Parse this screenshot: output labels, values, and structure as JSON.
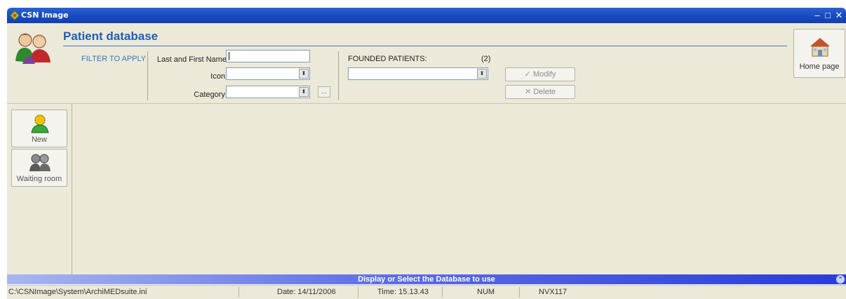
{
  "window": {
    "title": "CSN Image",
    "min": "–",
    "max": "□",
    "close": "✕"
  },
  "header": {
    "title": "Patient database",
    "filter_label": "FILTER TO APPLY",
    "name_label": "Last and First Name:",
    "name_value": "",
    "icon_label": "Icon:",
    "icon_value": "",
    "category_label": "Category:",
    "category_value": "",
    "category_more": "...",
    "founded_label": "FOUNDED PATIENTS:",
    "founded_count": "(2)",
    "patients_value": "",
    "modify_label": "Modify",
    "delete_label": "Delete",
    "home_label": "Home page"
  },
  "sidebar": {
    "items": [
      {
        "label": "New",
        "icon": "person-green-icon"
      },
      {
        "label": "Waiting room",
        "icon": "people-gray-icon"
      }
    ]
  },
  "infobar": {
    "text": "Display or Select the Database to use"
  },
  "status": {
    "path": "C:\\CSNImage\\System\\ArchiMEDsuite.ini",
    "date": "Date: 14/11/2006",
    "time": "Time: 15.13.43",
    "num": "NUM",
    "code": "NVX117"
  },
  "colors": {
    "title_blue": "#1f5fb8",
    "accent_blue": "#2f78c9",
    "panel": "#ece9d8"
  }
}
